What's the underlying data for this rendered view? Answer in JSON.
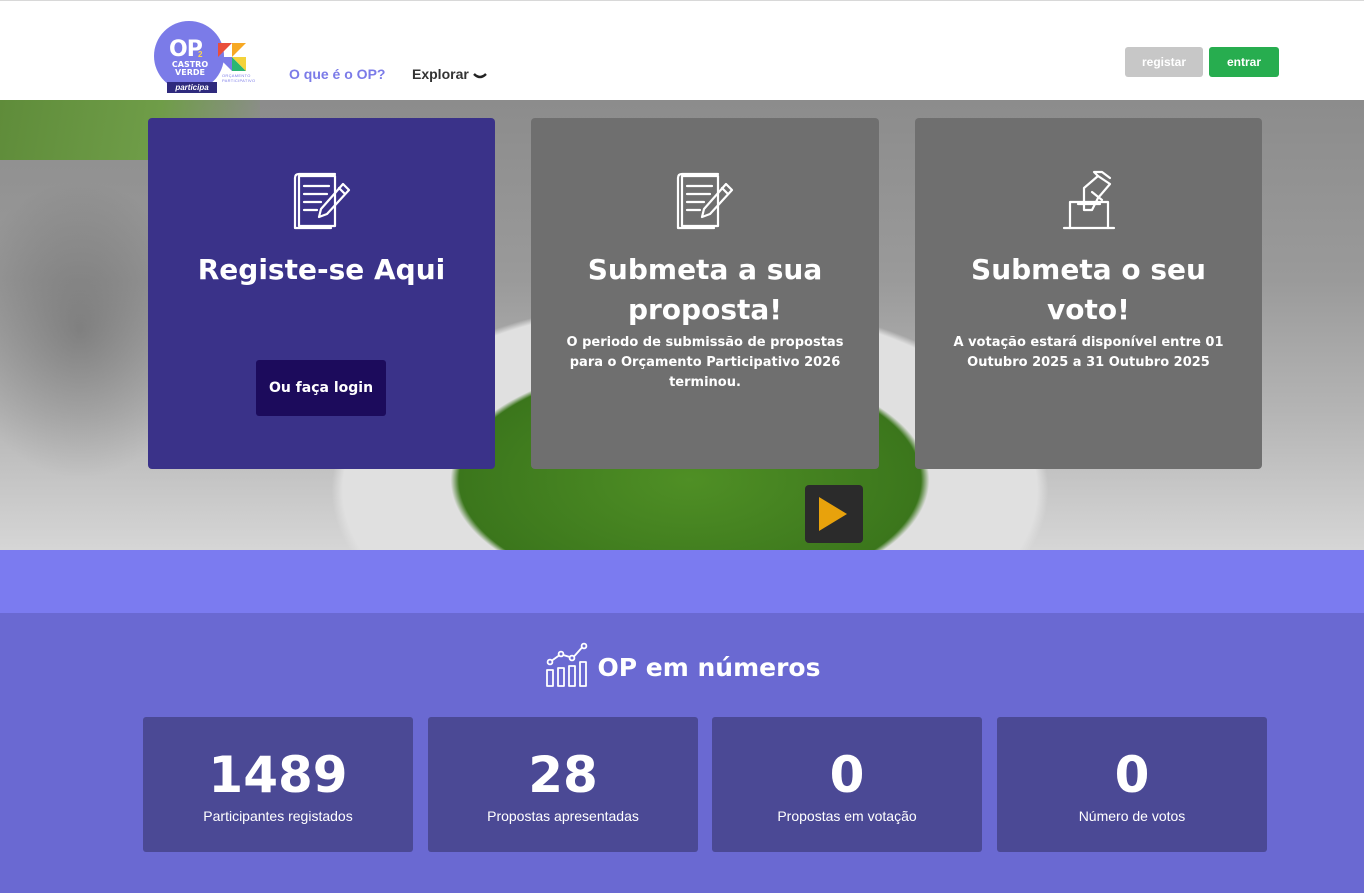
{
  "header": {
    "logo": {
      "op": "OP",
      "op_superscript": "2",
      "town": "CASTRO VERDE",
      "participa": "participa",
      "subtitle": "ORÇAMENTO PARTICIPATIVO"
    },
    "nav": {
      "what_is": "O que é o OP?",
      "explore": "Explorar"
    },
    "register_label": "registar",
    "enter_label": "entrar"
  },
  "hero": {
    "cards": [
      {
        "title": "Registe-se Aqui",
        "button": "Ou faça login",
        "icon": "document-pencil-icon"
      },
      {
        "title": "Submeta a sua proposta!",
        "text": "O periodo de submissão de propostas para o Orçamento Participativo 2026 terminou.",
        "icon": "document-pencil-icon"
      },
      {
        "title": "Submeta o seu voto!",
        "text": "A votação estará disponível entre 01 Outubro 2025 a 31 Outubro 2025",
        "icon": "ballot-box-icon"
      }
    ]
  },
  "stats": {
    "title": "OP em números",
    "icon": "chart-growth-icon",
    "items": [
      {
        "value": "1489",
        "label": "Participantes registados"
      },
      {
        "value": "28",
        "label": "Propostas apresentadas"
      },
      {
        "value": "0",
        "label": "Propostas em votação"
      },
      {
        "value": "0",
        "label": "Número de votos"
      }
    ]
  },
  "colors": {
    "brand_purple": "#7b7be8",
    "card_dark": "#3a3289",
    "card_gray": "#6f6f6f",
    "login_button": "#1c0b5c",
    "enter_button": "#27ad4f",
    "register_button": "#c7c7c7",
    "band": "#7b7bf0",
    "stats_bg": "#6a69d2",
    "stat_box": "#4b4995"
  }
}
